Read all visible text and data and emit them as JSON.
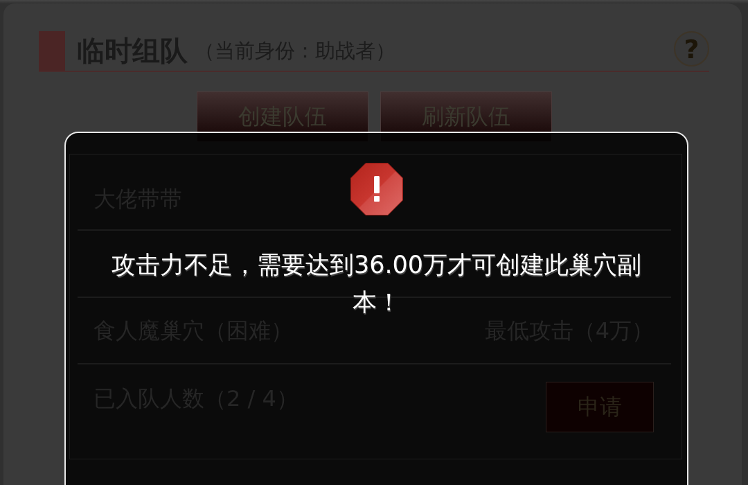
{
  "header": {
    "title": "临时组队",
    "subtitle": "（当前身份：助战者）",
    "help_button": "?"
  },
  "actions": [
    "创建队伍",
    "刷新队伍"
  ],
  "team_card": {
    "team_title": "大佬带带",
    "dungeon": "食人魔巢穴（困难）",
    "requirement": "最低攻击（4万）",
    "members": "已入队人数（2 / 4）",
    "apply_button": "申请"
  },
  "alert": {
    "message": "攻击力不足，需要达到36.00万才可创建此巢穴副本！"
  }
}
